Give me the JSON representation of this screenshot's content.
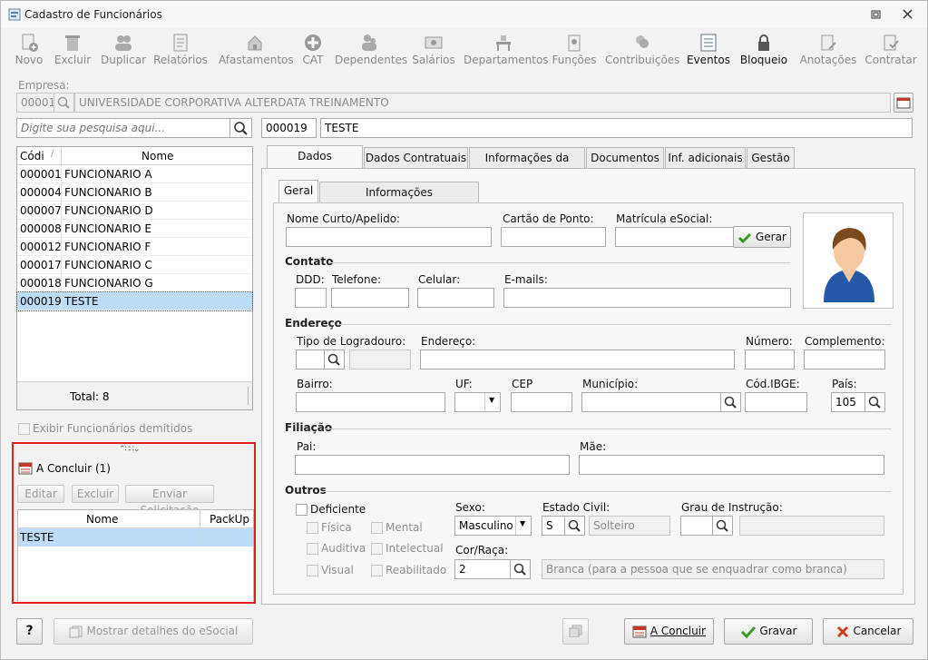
{
  "window": {
    "title": "Cadastro de Funcionários"
  },
  "toolbar": [
    {
      "label": "Novo",
      "icon": "new-user-icon"
    },
    {
      "label": "Excluir",
      "icon": "trash-icon"
    },
    {
      "label": "Duplicar",
      "icon": "users-icon"
    },
    {
      "label": "Relatórios",
      "icon": "report-icon"
    },
    {
      "label": "Afastamentos",
      "icon": "house-arrow-icon"
    },
    {
      "label": "CAT",
      "icon": "plus-cross-icon"
    },
    {
      "label": "Dependentes",
      "icon": "dependents-icon"
    },
    {
      "label": "Salários",
      "icon": "money-icon"
    },
    {
      "label": "Departamentos",
      "icon": "desk-icon"
    },
    {
      "label": "Funções",
      "icon": "badge-icon"
    },
    {
      "label": "Contribuições",
      "icon": "contribution-icon"
    },
    {
      "label": "Eventos",
      "icon": "list-icon"
    },
    {
      "label": "Bloqueio",
      "icon": "lock-icon"
    },
    {
      "label": "Anotações",
      "icon": "notes-icon"
    },
    {
      "label": "Contratar",
      "icon": "contract-icon"
    }
  ],
  "empresa": {
    "label": "Empresa:",
    "code": "00001",
    "name": "UNIVERSIDADE CORPORATIVA ALTERDATA TREINAMENTO"
  },
  "search": {
    "placeholder": "Digite sua pesquisa aqui..."
  },
  "selected": {
    "code": "000019",
    "name": "TESTE"
  },
  "employee_list": {
    "col_code": "Códi",
    "col_name": "Nome",
    "rows": [
      {
        "code": "000001",
        "name": "FUNCIONARIO A"
      },
      {
        "code": "000004",
        "name": "FUNCIONARIO B"
      },
      {
        "code": "000007",
        "name": "FUNCIONARIO D"
      },
      {
        "code": "000008",
        "name": "FUNCIONARIO E"
      },
      {
        "code": "000012",
        "name": "FUNCIONARIO F"
      },
      {
        "code": "000017",
        "name": "FUNCIONARIO C"
      },
      {
        "code": "000018",
        "name": "FUNCIONARIO G"
      },
      {
        "code": "000019",
        "name": "TESTE"
      }
    ],
    "total": "Total: 8"
  },
  "show_dismissed": "Exibir Funcionários demitidos",
  "pending": {
    "title": "A Concluir (1)",
    "edit": "Editar",
    "delete": "Excluir",
    "send": "Enviar Solicitação",
    "col_name": "Nome",
    "col_packup": "PackUp",
    "rows": [
      {
        "name": "TESTE",
        "packup": ""
      }
    ]
  },
  "tabs": [
    "Dados Cadastrais",
    "Dados Contratuais",
    "Informações da folha",
    "Documentos",
    "Inf. adicionais",
    "Gestão"
  ],
  "subtabs": [
    "Geral",
    "Informações Complementares"
  ],
  "form": {
    "nome_curto": "Nome Curto/Apelido:",
    "cartao": "Cartão de Ponto:",
    "matricula": "Matrícula eSocial:",
    "gerar": "Gerar",
    "contato": "Contato",
    "ddd": "DDD:",
    "telefone": "Telefone:",
    "celular": "Celular:",
    "emails": "E-mails:",
    "endereco_sec": "Endereço",
    "tipo_logradouro": "Tipo de Logradouro:",
    "endereco": "Endereço:",
    "numero": "Número:",
    "complemento": "Complemento:",
    "bairro": "Bairro:",
    "uf": "UF:",
    "cep": "CEP",
    "municipio": "Município:",
    "cod_ibge": "Cód.IBGE:",
    "pais": "País:",
    "pais_value": "105",
    "filiacao": "Filiação",
    "pai": "Pai:",
    "mae": "Mãe:",
    "outros": "Outros",
    "deficiente": "Deficiente",
    "fisica": "Física",
    "mental": "Mental",
    "auditiva": "Auditiva",
    "intelectual": "Intelectual",
    "visual": "Visual",
    "reabilitado": "Reabilitado",
    "sexo": "Sexo:",
    "sexo_value": "Masculino",
    "estado_civil": "Estado Civil:",
    "estado_civil_code": "S",
    "estado_civil_desc": "Solteiro",
    "grau_instrucao": "Grau de Instrução:",
    "cor_raca": "Cor/Raça:",
    "cor_raca_code": "2",
    "cor_raca_desc": "Branca (para a pessoa que se enquadrar como branca)"
  },
  "footer": {
    "help": "?",
    "details": "Mostrar detalhes do eSocial",
    "a_concluir": "A Concluir",
    "gravar": "Gravar",
    "cancelar": "Cancelar"
  },
  "colors": {
    "accent_red": "#e02020",
    "selection": "#bcdcf7"
  }
}
